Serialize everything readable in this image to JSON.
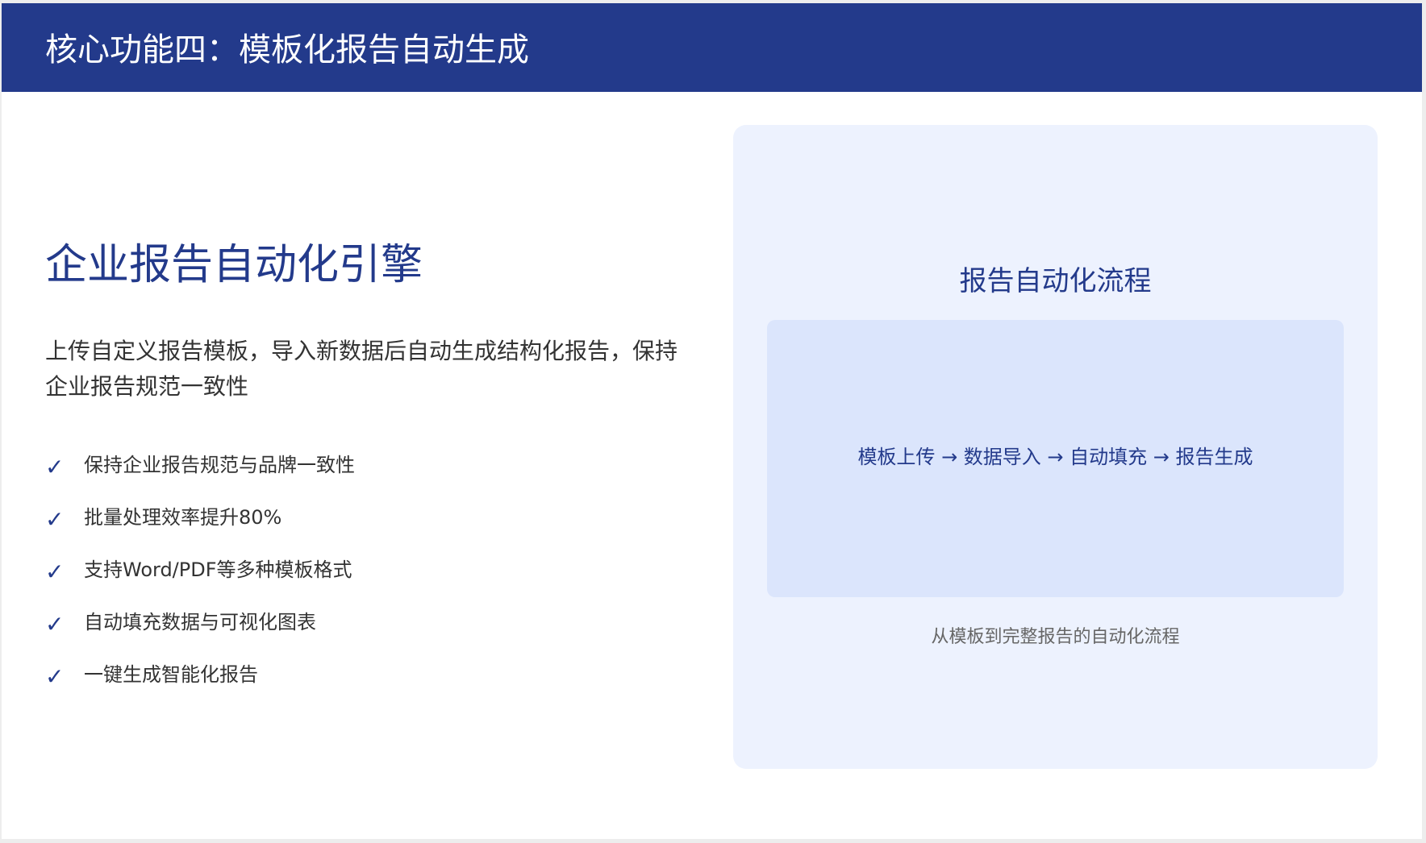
{
  "header": {
    "title": "核心功能四：模板化报告自动生成"
  },
  "left": {
    "heading": "企业报告自动化引擎",
    "description": "上传自定义报告模板，导入新数据后自动生成结构化报告，保持企业报告规范一致性",
    "check_icon": "✓",
    "features": [
      "保持企业报告规范与品牌一致性",
      "批量处理效率提升80%",
      "支持Word/PDF等多种模板格式",
      "自动填充数据与可视化图表",
      "一键生成智能化报告"
    ]
  },
  "panel": {
    "title": "报告自动化流程",
    "flow": "模板上传 → 数据导入 → 自动填充 → 报告生成",
    "caption": "从模板到完整报告的自动化流程"
  },
  "colors": {
    "header_bg": "#233a8b",
    "accent": "#233a8b",
    "panel_bg": "#edf2fe",
    "flow_box_bg": "#dbe5fc"
  }
}
